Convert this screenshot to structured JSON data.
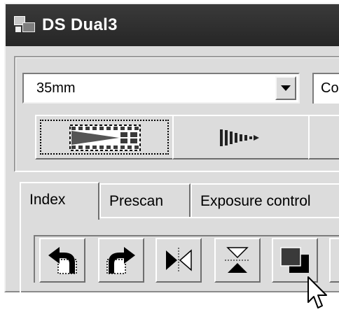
{
  "window": {
    "title": "DS Dual3"
  },
  "film_type": {
    "selected": "35mm"
  },
  "second_select": {
    "visible_text": "Co"
  },
  "tabs": [
    {
      "label": "Index"
    },
    {
      "label": "Prescan"
    },
    {
      "label": "Exposure control"
    }
  ],
  "icons": {
    "app": "scanner-app-icon",
    "film_strip": "film-strip-icon",
    "eject": "film-eject-icon",
    "rotate_left": "rotate-left-icon",
    "rotate_right": "rotate-right-icon",
    "flip_horizontal": "flip-horizontal-icon",
    "flip_vertical": "flip-vertical-icon",
    "negative": "negative-icon",
    "cursor": "mouse-pointer-icon"
  },
  "colors": {
    "titlebar": "#2f2f2f",
    "face": "#dcdcdc"
  }
}
